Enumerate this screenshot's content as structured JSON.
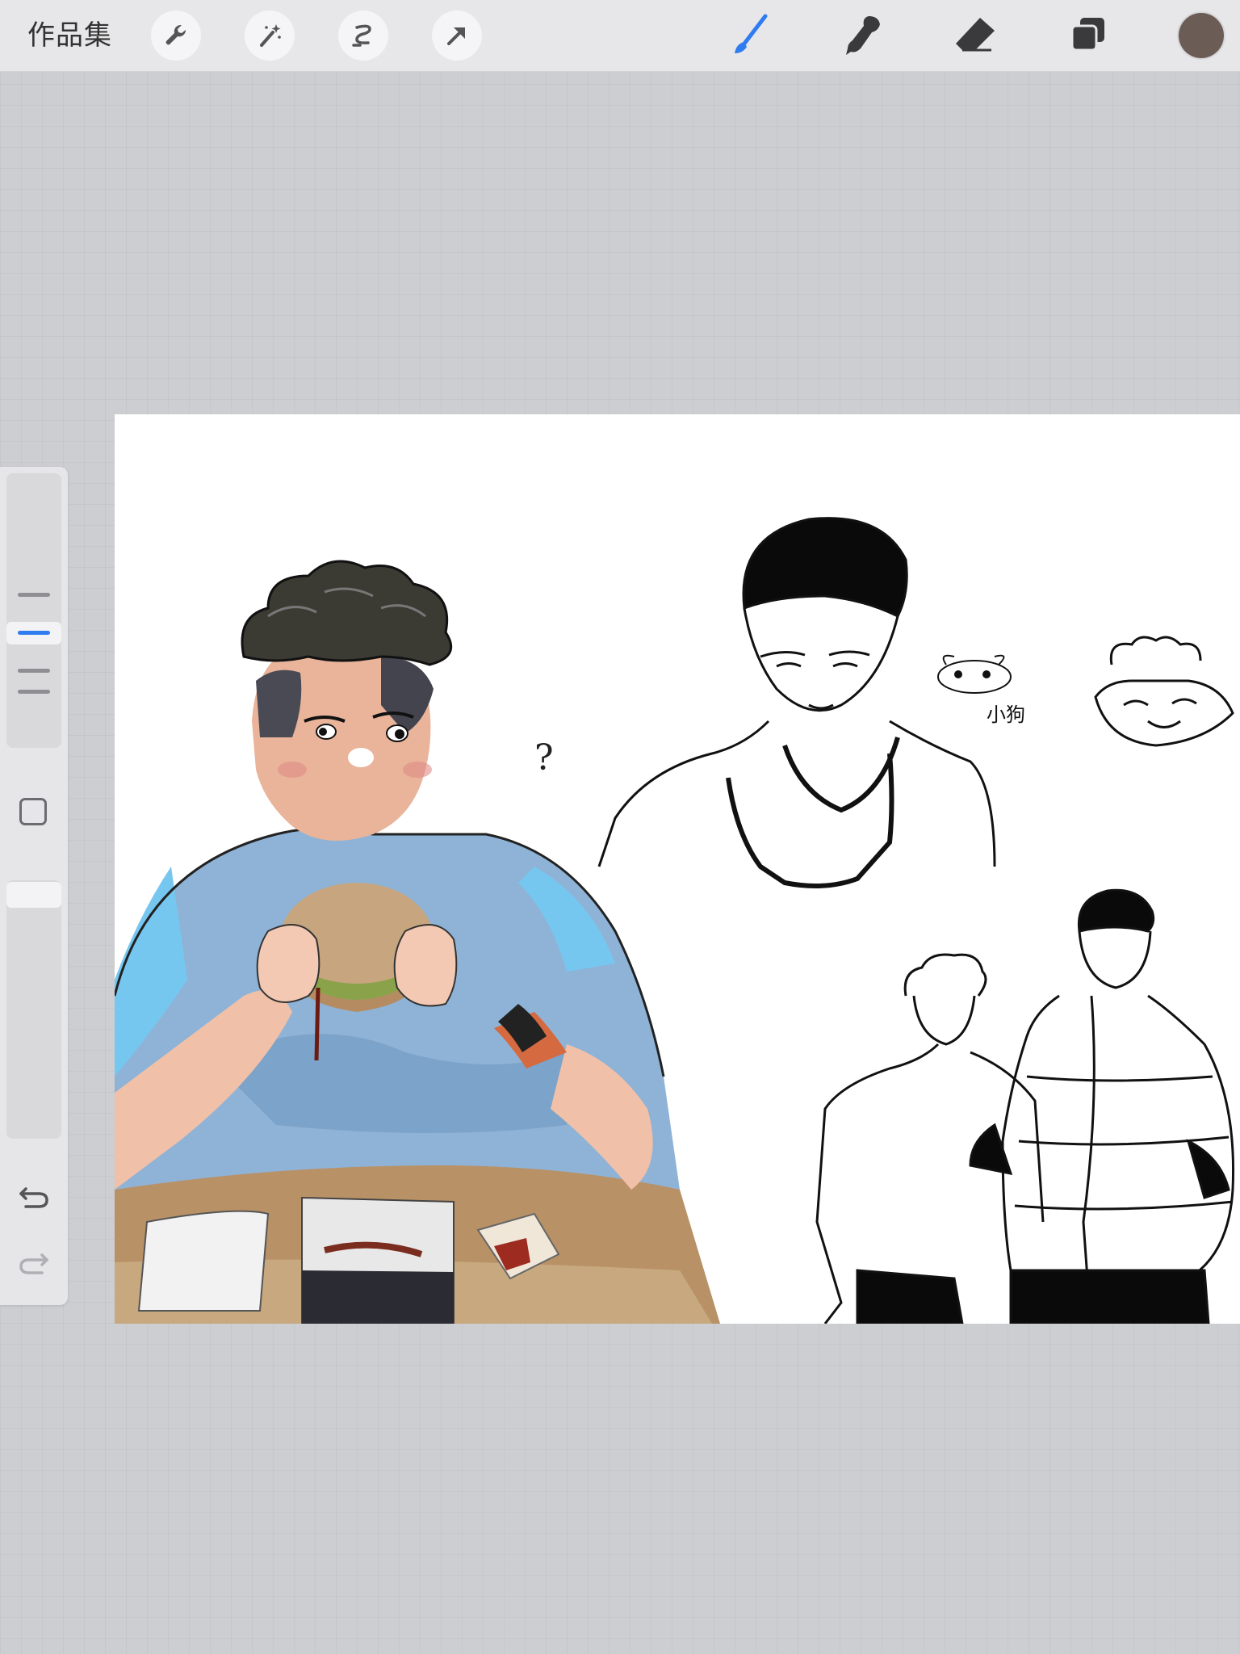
{
  "topbar": {
    "gallery_label": "作品集",
    "left_tools": [
      "wrench-icon",
      "magic-wand-icon",
      "selection-icon",
      "transform-arrow-icon"
    ],
    "right_tools": [
      "brush-icon",
      "smudge-icon",
      "eraser-icon",
      "layers-icon"
    ],
    "active_tool": "brush",
    "current_color": "#6b5d56",
    "accent_color": "#2f7cf0"
  },
  "canvas": {
    "sketch_note_dog": "小狗",
    "sketch_note_question": "?"
  }
}
